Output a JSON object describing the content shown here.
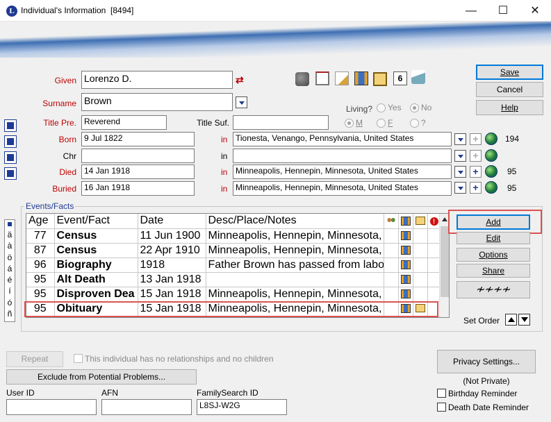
{
  "window": {
    "title": "Individual's Information",
    "record_id": "[8494]",
    "app_icon_letter": "L"
  },
  "form": {
    "given_label": "Given",
    "given_value": "Lorenzo D.",
    "surname_label": "Surname",
    "surname_value": "Brown",
    "title_pre_label": "Title Pre.",
    "title_pre_value": "Reverend",
    "title_suf_label": "Title Suf.",
    "title_suf_value": "",
    "living_label": "Living?",
    "living_yes": "Yes",
    "living_no": "No",
    "sex_m": "M",
    "sex_f": "F",
    "sex_unknown": "?",
    "in_label": "in",
    "events": [
      {
        "label": "Born",
        "date": "9 Jul 1822",
        "place": "Tionesta, Venango, Pennsylvania, United States",
        "count": "194"
      },
      {
        "label": "Chr",
        "date": "",
        "place": "",
        "count": ""
      },
      {
        "label": "Died",
        "date": "14 Jan 1918",
        "place": "Minneapolis, Hennepin, Minnesota, United States",
        "count": "95"
      },
      {
        "label": "Buried",
        "date": "16 Jan 1918",
        "place": "Minneapolis, Hennepin, Minnesota, United States",
        "count": "95"
      }
    ]
  },
  "buttons": {
    "save": "Save",
    "cancel": "Cancel",
    "help": "Help",
    "add": "Add",
    "edit": "Edit",
    "options": "Options",
    "share": "Share",
    "set_order": "Set Order",
    "repeat": "Repeat",
    "exclude": "Exclude from Potential Problems...",
    "privacy": "Privacy Settings..."
  },
  "events_facts": {
    "group_label": "Events/Facts",
    "columns": [
      "Age",
      "Event/Fact",
      "Date",
      "Desc/Place/Notes"
    ],
    "rows": [
      {
        "age": "77",
        "fact": "Census",
        "date": "11 Jun 1900",
        "place": "Minneapolis, Hennepin, Minnesota, U"
      },
      {
        "age": "87",
        "fact": "Census",
        "date": "22 Apr 1910",
        "place": "Minneapolis, Hennepin, Minnesota, U"
      },
      {
        "age": "96",
        "fact": "Biography",
        "date": "1918",
        "place": "Father Brown has passed from labor"
      },
      {
        "age": "95",
        "fact": "Alt Death",
        "date": "13 Jan 1918",
        "place": ""
      },
      {
        "age": "95",
        "fact": "Disproven Dea",
        "date": "15 Jan 1918",
        "place": "Minneapolis, Hennepin, Minnesota, U"
      },
      {
        "age": "95",
        "fact": "Obituary",
        "date": "15 Jan 1918",
        "place": "Minneapolis, Hennepin, Minnesota, U"
      }
    ],
    "alpha_chars": [
      "ä",
      "à",
      "ö",
      "á",
      "é",
      "í",
      "ó",
      "ñ"
    ]
  },
  "bottom": {
    "no_relationships": "This individual has no relationships and no children",
    "user_id_label": "User ID",
    "user_id_value": "",
    "afn_label": "AFN",
    "afn_value": "",
    "familysearch_label": "FamilySearch ID",
    "familysearch_value": "L8SJ-W2G",
    "privacy_status": "(Not Private)",
    "birthday_reminder": "Birthday Reminder",
    "death_reminder": "Death Date Reminder"
  },
  "colors": {
    "required_label": "#c00000",
    "highlight_box": "#d9534f",
    "accent": "#1f3a93"
  }
}
